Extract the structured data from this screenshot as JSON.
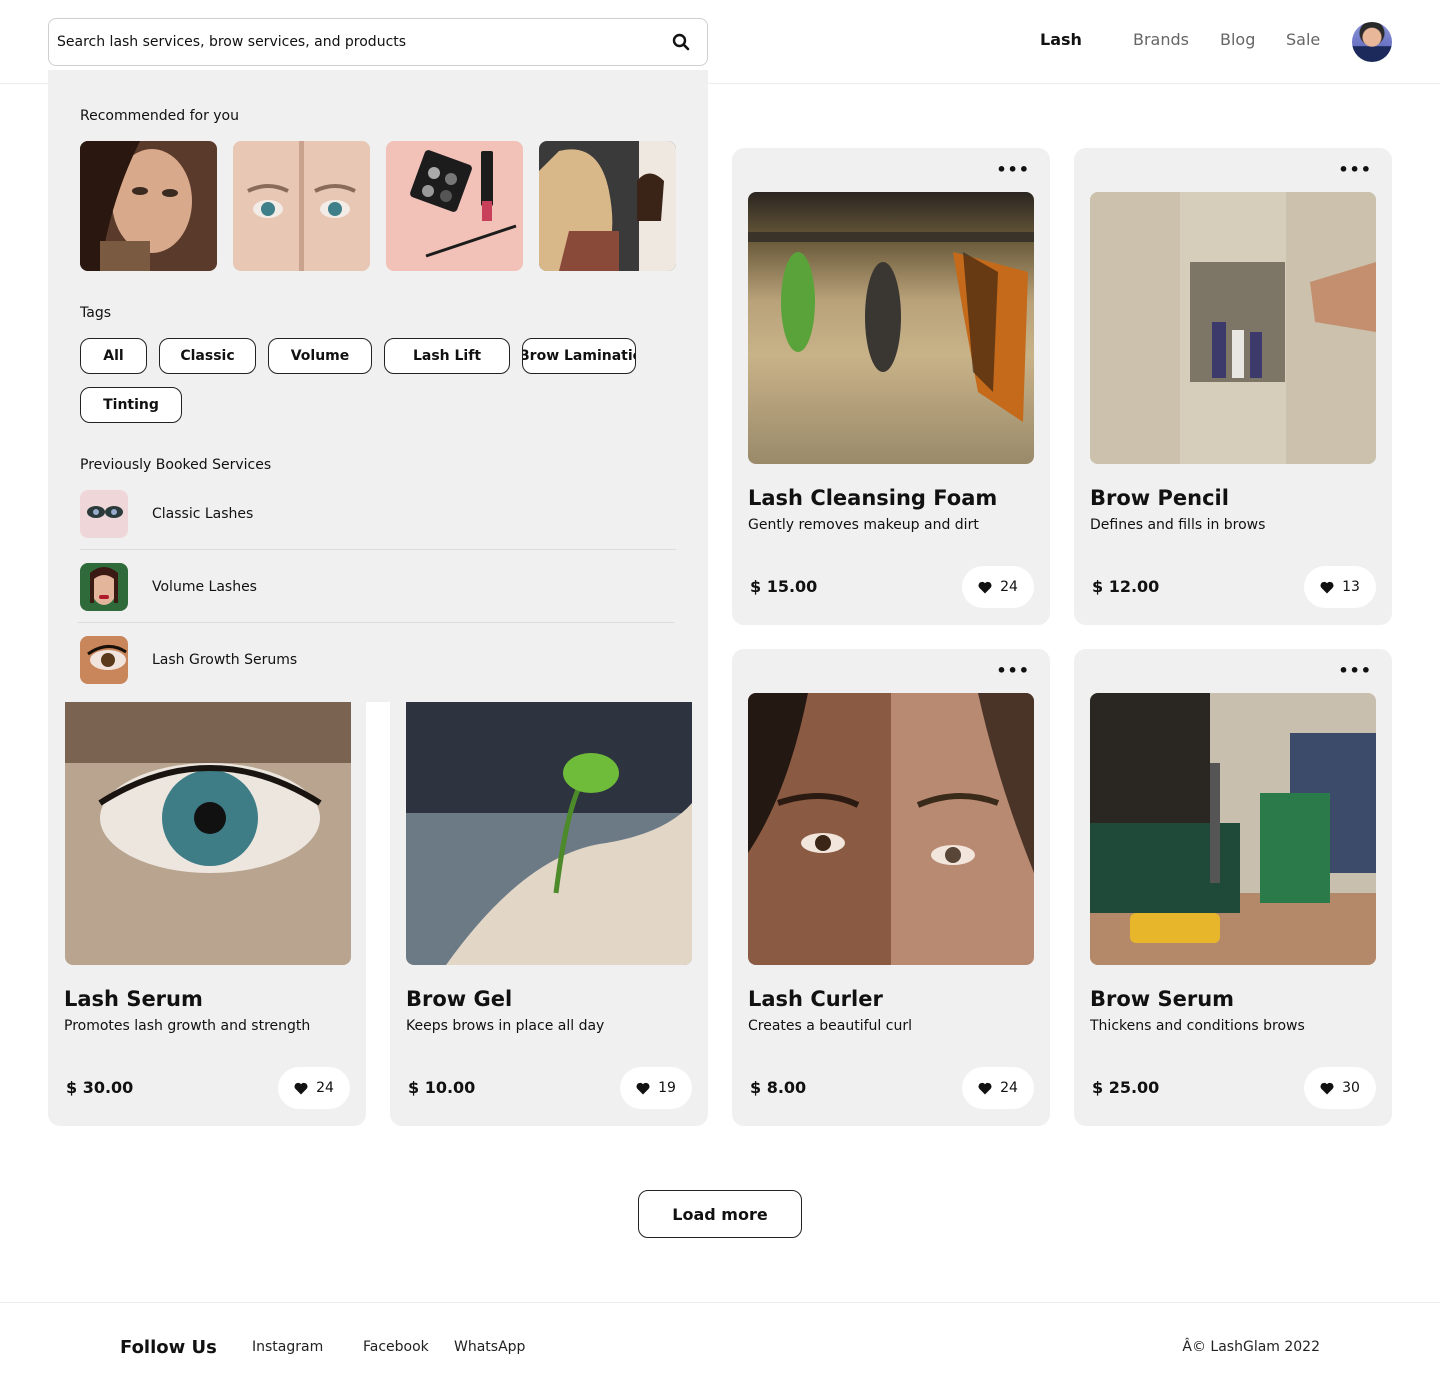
{
  "search": {
    "placeholder": "Search lash services, brow services, and products"
  },
  "nav": {
    "lash": "Lash",
    "brands": "Brands",
    "blog": "Blog",
    "sale": "Sale"
  },
  "dropdown": {
    "recommended_label": "Recommended for you",
    "tags_label": "Tags",
    "tags": [
      "All",
      "Classic",
      "Volume",
      "Lash Lift",
      "Brow Lamination",
      "Tinting"
    ],
    "booked_label": "Previously Booked Services",
    "booked": [
      {
        "label": "Classic Lashes"
      },
      {
        "label": "Volume Lashes"
      },
      {
        "label": "Lash Growth Serums"
      }
    ]
  },
  "products": [
    {
      "title": "Lash Cleansing Foam",
      "desc": "Gently removes makeup and dirt",
      "price": "$ 15.00",
      "likes": "24"
    },
    {
      "title": "Brow Pencil",
      "desc": "Defines and fills in brows",
      "price": "$ 12.00",
      "likes": "13"
    },
    {
      "title": "Lash Serum",
      "desc": "Promotes lash growth and strength",
      "price": "$ 30.00",
      "likes": "24"
    },
    {
      "title": "Brow Gel",
      "desc": "Keeps brows in place all day",
      "price": "$ 10.00",
      "likes": "19"
    },
    {
      "title": "Lash Curler",
      "desc": "Creates a beautiful curl",
      "price": "$ 8.00",
      "likes": "24"
    },
    {
      "title": "Brow Serum",
      "desc": "Thickens and conditions brows",
      "price": "$ 25.00",
      "likes": "30"
    }
  ],
  "menu_dots": "•••",
  "load_more": "Load more",
  "footer": {
    "follow": "Follow Us",
    "instagram": "Instagram",
    "facebook": "Facebook",
    "whatsapp": "WhatsApp",
    "copyright": "Â© LashGlam 2022"
  },
  "icons": {
    "search": "search-icon",
    "heart": "heart-icon",
    "more": "more-horizontal-icon"
  }
}
